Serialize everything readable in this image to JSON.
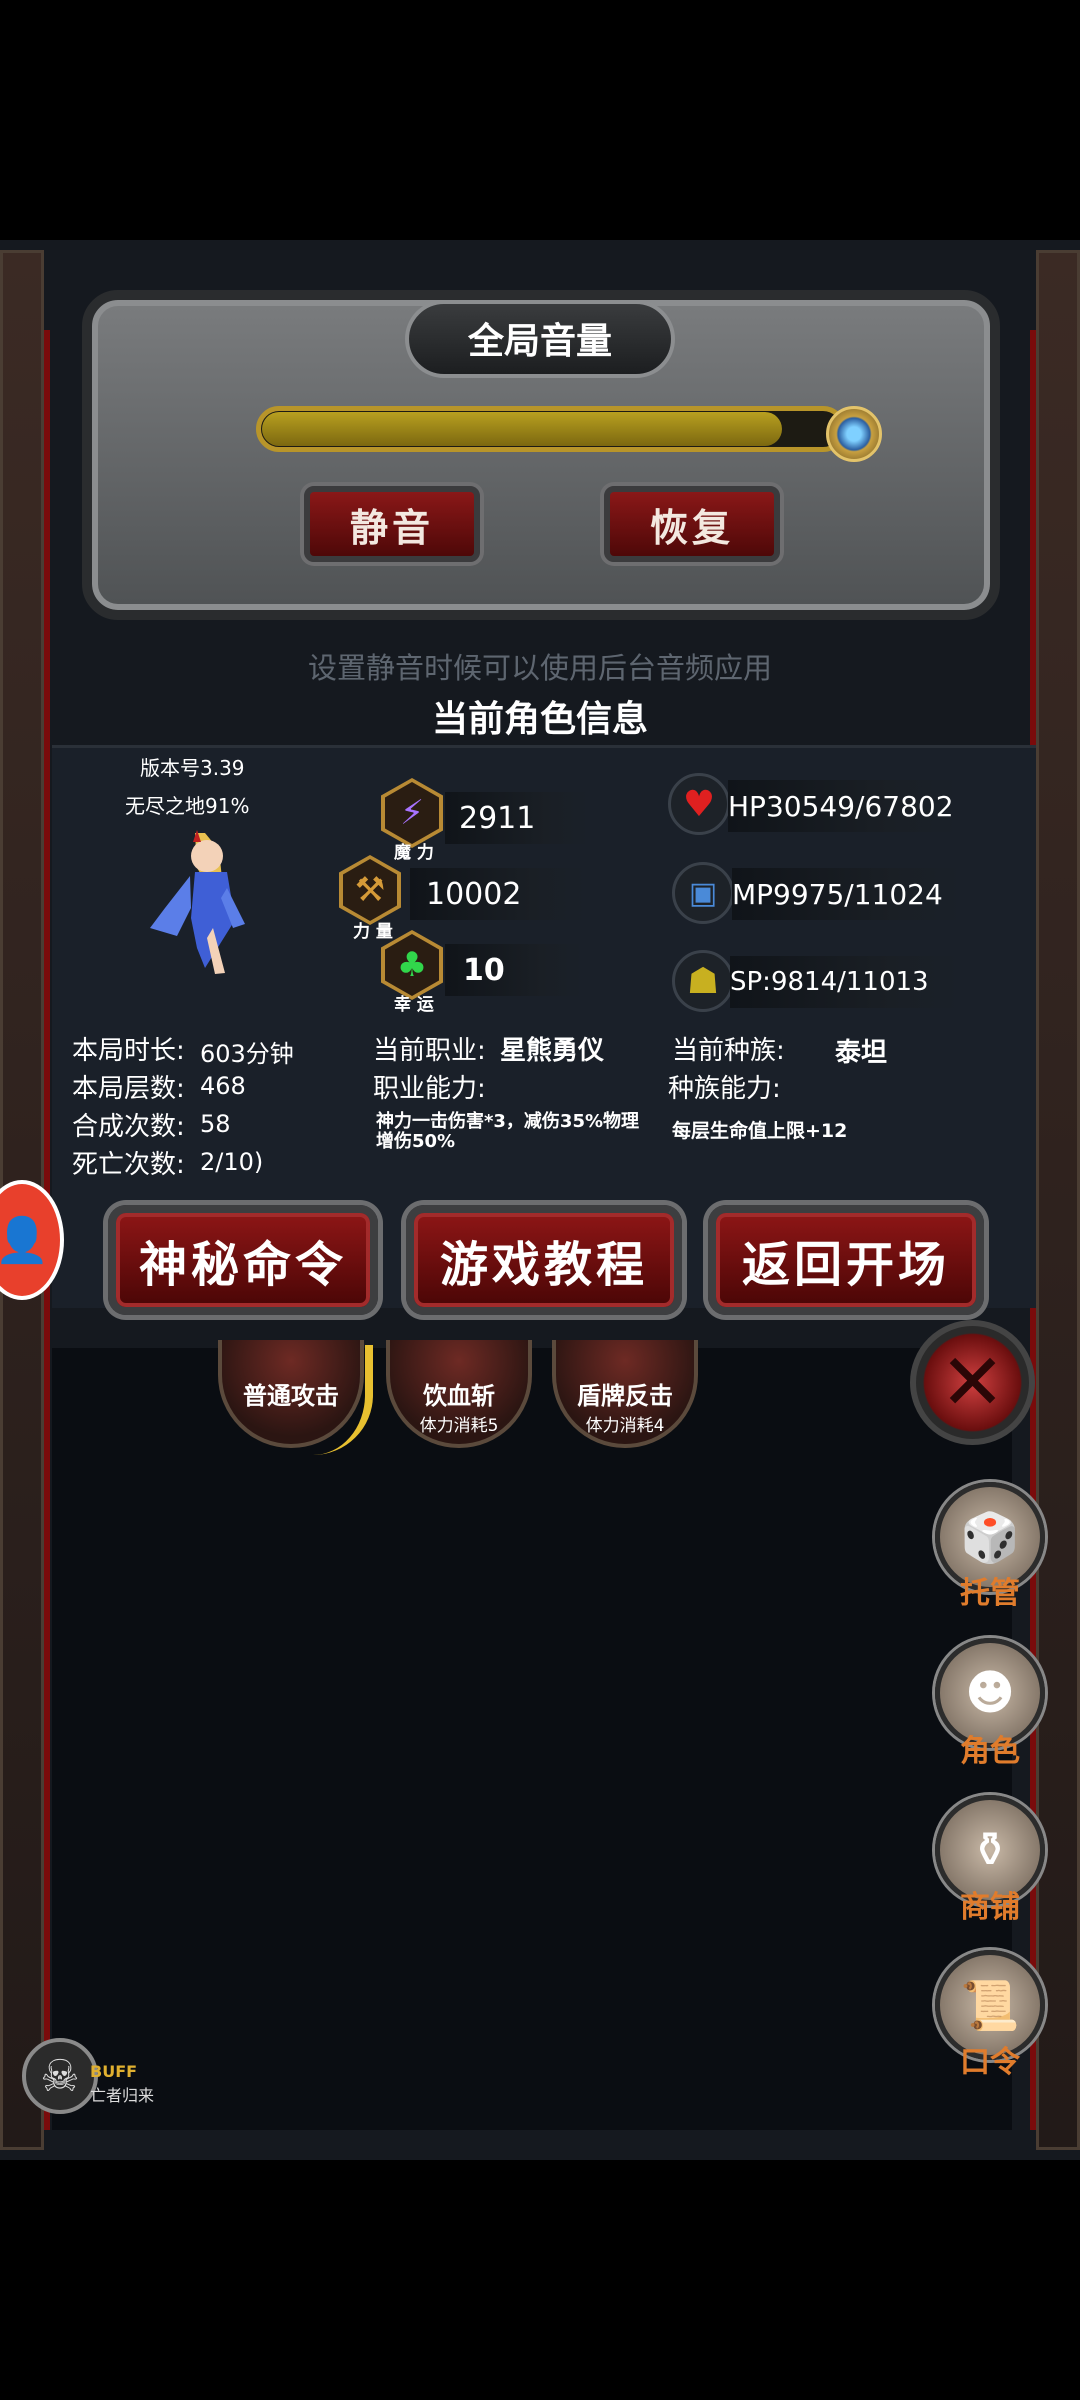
{
  "volume": {
    "title": "全局音量",
    "level": 0.9,
    "mute_label": "静音",
    "restore_label": "恢复",
    "hint": "设置静音时候可以使用后台音频应用"
  },
  "info": {
    "title": "当前角色信息",
    "version": "版本号3.39",
    "zone": "无尽之地91%",
    "stats": {
      "magic": {
        "value": "2911",
        "label": "魔 力"
      },
      "power": {
        "value": "10002",
        "label": "力 量"
      },
      "luck": {
        "value": "10",
        "label": "幸 运"
      }
    },
    "hp": "HP30549/67802",
    "mp": "MP9975/11024",
    "sp": "SP:9814/11013",
    "run": [
      {
        "label": "本局时长:",
        "value": "603分钟"
      },
      {
        "label": "本局层数:",
        "value": "468"
      },
      {
        "label": "合成次数:",
        "value": "58"
      },
      {
        "label": "死亡次数:",
        "value": "2/10)"
      }
    ],
    "job_label": "当前职业:",
    "job": "星熊勇仪",
    "job_ability_label": "职业能力:",
    "job_ability": "神力一击伤害*3，减伤35%物理增伤50%",
    "race_label": "当前种族:",
    "race": "泰坦",
    "race_ability_label": "种族能力:",
    "race_ability": "每层生命值上限+12"
  },
  "buttons": {
    "mystery": "神秘命令",
    "tutorial": "游戏教程",
    "back": "返回开场"
  },
  "skills": [
    {
      "name": "普通攻击",
      "cost": ""
    },
    {
      "name": "饮血斩",
      "cost": "体力消耗5"
    },
    {
      "name": "盾牌反击",
      "cost": "体力消耗4"
    }
  ],
  "side": {
    "auto": "托管",
    "role": "角色",
    "shop": "商铺",
    "code": "口令"
  },
  "buff": {
    "title": "BUFF",
    "name": "亡者归来"
  },
  "colors": {
    "accent": "#e07c2c",
    "button_red": "#8a1818"
  }
}
